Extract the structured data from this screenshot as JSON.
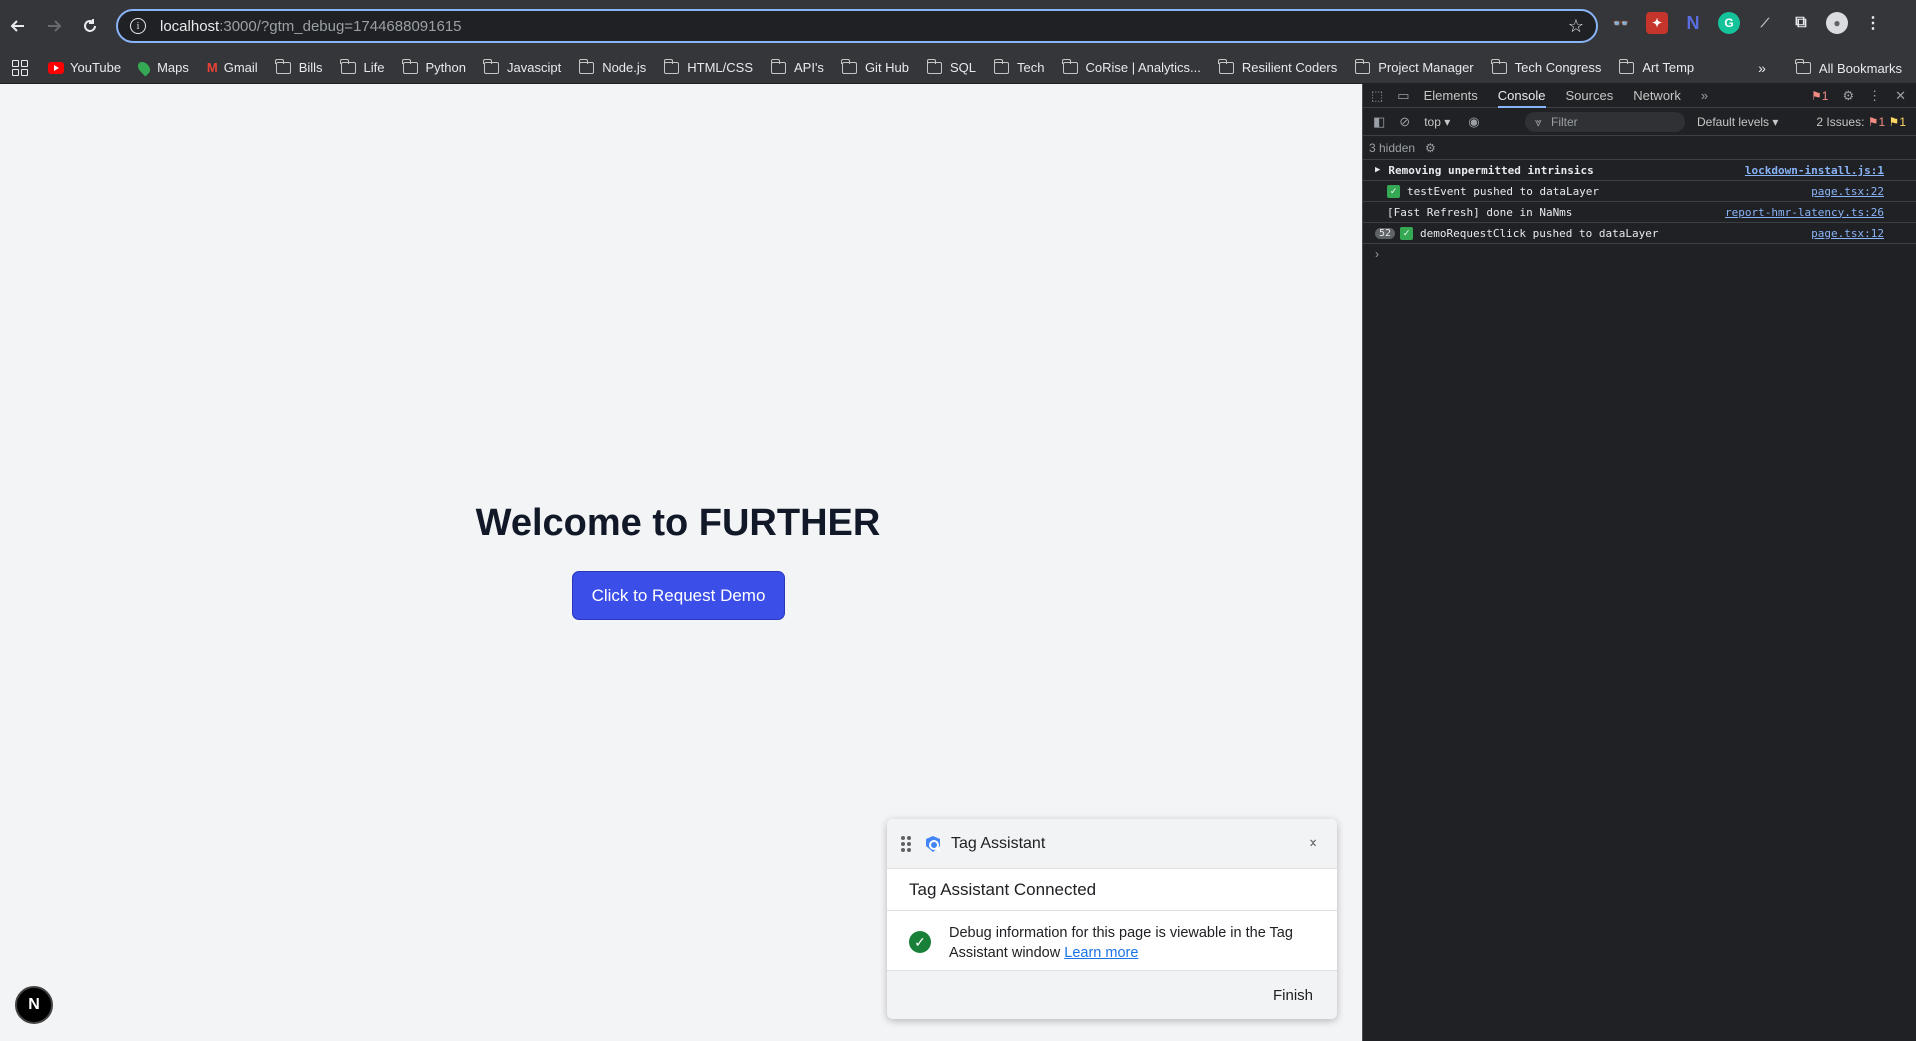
{
  "browser": {
    "url_host": "localhost",
    "url_rest": ":3000/?gtm_debug=1744688091615"
  },
  "bookmarks": [
    {
      "label": "YouTube",
      "icon": "youtube-icon"
    },
    {
      "label": "Maps",
      "icon": "maps-icon"
    },
    {
      "label": "Gmail",
      "icon": "gmail-icon"
    },
    {
      "label": "Bills",
      "icon": "folder-icon"
    },
    {
      "label": "Life",
      "icon": "folder-icon"
    },
    {
      "label": "Python",
      "icon": "folder-icon"
    },
    {
      "label": "Javascipt",
      "icon": "folder-icon"
    },
    {
      "label": "Node.js",
      "icon": "folder-icon"
    },
    {
      "label": "HTML/CSS",
      "icon": "folder-icon"
    },
    {
      "label": "API's",
      "icon": "folder-icon"
    },
    {
      "label": "Git Hub",
      "icon": "folder-icon"
    },
    {
      "label": "SQL",
      "icon": "folder-icon"
    },
    {
      "label": "Tech",
      "icon": "folder-icon"
    },
    {
      "label": "CoRise | Analytics...",
      "icon": "folder-icon"
    },
    {
      "label": "Resilient Coders",
      "icon": "folder-icon"
    },
    {
      "label": "Project Manager",
      "icon": "folder-icon"
    },
    {
      "label": "Tech Congress",
      "icon": "folder-icon"
    },
    {
      "label": "Art Temp",
      "icon": "folder-icon"
    }
  ],
  "all_bookmarks": "All Bookmarks",
  "page": {
    "heading": "Welcome to FURTHER",
    "button": "Click to Request Demo",
    "next_badge": "N"
  },
  "tag_assistant": {
    "title": "Tag Assistant",
    "connected": "Tag Assistant Connected",
    "message": "Debug information for this page is viewable in the Tag Assistant window",
    "link": "Learn more",
    "finish": "Finish"
  },
  "devtools": {
    "tabs": [
      "Elements",
      "Console",
      "Sources",
      "Network"
    ],
    "active_tab": "Console",
    "context": "top",
    "filter_placeholder": "Filter",
    "levels": "Default levels",
    "issues": "2 Issues:",
    "issue_count_a": "1",
    "issue_count_b": "1",
    "error_badge": "1",
    "hidden": "3 hidden",
    "logs": [
      {
        "text": "Removing unpermitted intrinsics",
        "source": "lockdown-install.js:1",
        "bold": true
      },
      {
        "text": "testEvent pushed to dataLayer",
        "source": "page.tsx:22",
        "check": true
      },
      {
        "text": "[Fast Refresh] done in NaNms",
        "source": "report-hmr-latency.ts:26"
      },
      {
        "text": "demoRequestClick pushed to dataLayer",
        "source": "page.tsx:12",
        "check": true,
        "count": "52"
      }
    ]
  },
  "colors": {
    "accent_button": "#3b4ee8",
    "page_background": "#f3f4f6",
    "devtools_background": "#202124",
    "link_blue": "#8ab4f8"
  }
}
